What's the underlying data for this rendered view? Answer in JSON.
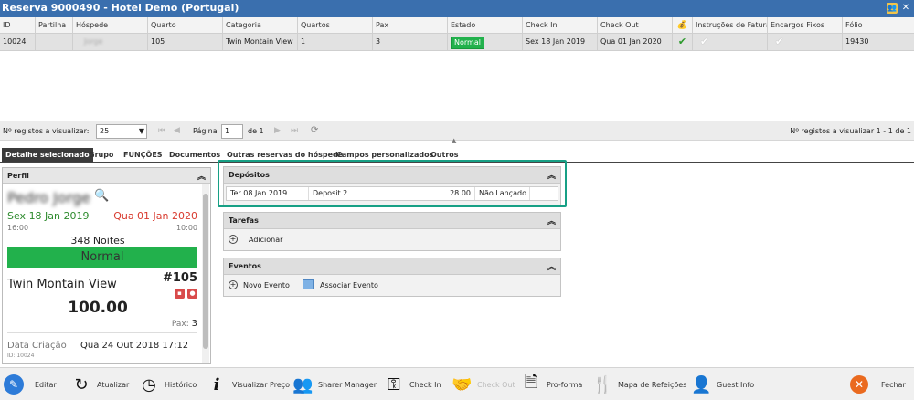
{
  "window": {
    "title": "Reserva 9000490 - Hotel Demo (Portugal)",
    "icons": [
      "users-icon",
      "close-icon"
    ]
  },
  "grid": {
    "columns": [
      {
        "key": "id",
        "label": "ID"
      },
      {
        "key": "partilha",
        "label": "Partilha"
      },
      {
        "key": "hospede",
        "label": "Hóspede"
      },
      {
        "key": "quarto",
        "label": "Quarto"
      },
      {
        "key": "categoria",
        "label": "Categoria"
      },
      {
        "key": "quartos",
        "label": "Quartos"
      },
      {
        "key": "pax",
        "label": "Pax"
      },
      {
        "key": "estado",
        "label": "Estado"
      },
      {
        "key": "checkin",
        "label": "Check In"
      },
      {
        "key": "checkout",
        "label": "Check Out"
      },
      {
        "key": "money",
        "label": ""
      },
      {
        "key": "instrucoes",
        "label": "Instruções de Faturaç"
      },
      {
        "key": "encargos",
        "label": "Encargos Fixos"
      },
      {
        "key": "folio",
        "label": "Fólio"
      }
    ],
    "row": {
      "id": "10024",
      "partilha": "",
      "hospede": "Jorge",
      "quarto": "105",
      "categoria": "Twin Montain View",
      "quartos": "1",
      "pax": "3",
      "estado": "Normal",
      "checkin": "Sex 18 Jan 2019",
      "checkout": "Qua 01 Jan 2020",
      "money_check": "✔",
      "instrucoes_check": "✔",
      "encargos_check": "✔",
      "folio": "19430"
    }
  },
  "pager": {
    "records_label": "Nº registos a visualizar:",
    "page_size": "25",
    "page_label": "Página",
    "page_value": "1",
    "of_label": "de 1",
    "summary": "Nº registos a visualizar 1 - 1 de 1"
  },
  "tabs": [
    {
      "label": "Detalhe selecionado",
      "active": true
    },
    {
      "label": "Grupo"
    },
    {
      "label": "FUNÇÕES"
    },
    {
      "label": "Documentos"
    },
    {
      "label": "Outras reservas do hóspede"
    },
    {
      "label": "Campos personalizados"
    },
    {
      "label": "Outros"
    }
  ],
  "perfil": {
    "title": "Perfil",
    "guest_name": "Pedro Jorge",
    "checkin_date": "Sex 18 Jan 2019",
    "checkout_date": "Qua 01 Jan 2020",
    "checkin_time": "16:00",
    "checkout_time": "10:00",
    "nights": "348 Noites",
    "status": "Normal",
    "room_type": "Twin Montain View",
    "room_number": "#105",
    "price": "100.00",
    "pax_label": "Pax:",
    "pax_value": "3",
    "created_label": "Data Criação",
    "created_value": "Qua 24 Out 2018 17:12",
    "id_label": "ID: 10024"
  },
  "depositos": {
    "title": "Depósitos",
    "row": {
      "date": "Ter 08 Jan 2019",
      "description": "Deposit 2",
      "amount": "28.00",
      "status": "Não Lançado"
    }
  },
  "tarefas": {
    "title": "Tarefas",
    "add_label": "Adicionar"
  },
  "eventos": {
    "title": "Eventos",
    "new_label": "Novo Evento",
    "assoc_label": "Associar Evento"
  },
  "toolbar": {
    "editar": "Editar",
    "atualizar": "Atualizar",
    "historico": "Histórico",
    "visualizar_preco": "Visualizar Preço",
    "sharer_manager": "Sharer Manager",
    "check_in": "Check In",
    "check_out": "Check Out",
    "pro_forma": "Pro-forma",
    "mapa_refeicoes": "Mapa de Refeições",
    "guest_info": "Guest Info",
    "fechar": "Fechar"
  },
  "colors": {
    "titlebar": "#3a6fae",
    "status_green": "#22b14c",
    "checkin_green": "#2e8b2e",
    "checkout_red": "#d83a2e",
    "highlight": "#17a085"
  }
}
